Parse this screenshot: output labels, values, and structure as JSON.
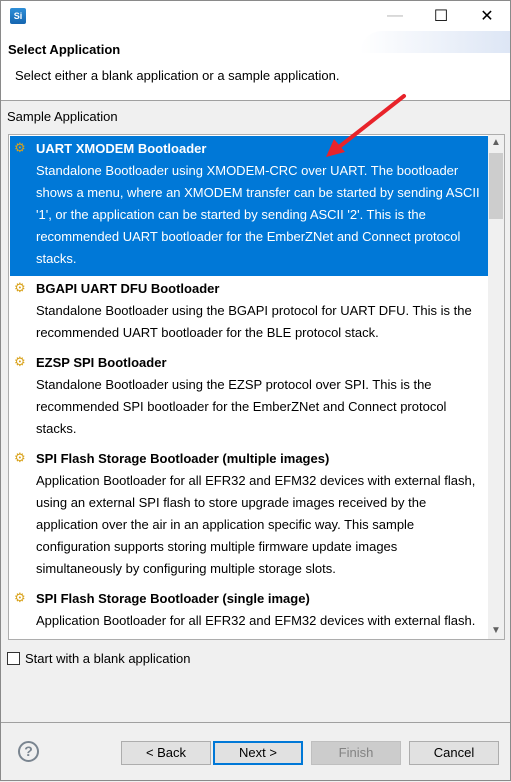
{
  "window": {
    "app_icon_text": "Si",
    "minimize": "—",
    "maximize": "☐",
    "close": "✕"
  },
  "header": {
    "title": "Select Application",
    "subtitle": "Select either a blank application or a sample application."
  },
  "group_label": "Sample Application",
  "items": [
    {
      "title": "UART XMODEM Bootloader",
      "selected": true,
      "lines": [
        "Standalone Bootloader using XMODEM-CRC over UART. The bootloader",
        "shows a menu, where an XMODEM transfer can be started by sending ASCII",
        "'1', or the application can be started by sending ASCII '2'. This is the",
        "recommended UART bootloader for the EmberZNet and Connect protocol",
        "stacks."
      ]
    },
    {
      "title": "BGAPI UART DFU Bootloader",
      "lines": [
        "Standalone Bootloader using the BGAPI protocol for UART DFU. This is the",
        "recommended UART bootloader for the BLE protocol stack."
      ]
    },
    {
      "title": "EZSP SPI Bootloader",
      "lines": [
        "Standalone Bootloader using the EZSP protocol over SPI. This is the",
        "recommended SPI bootloader for the EmberZNet and Connect protocol",
        "stacks."
      ]
    },
    {
      "title": "SPI Flash Storage Bootloader (multiple images)",
      "lines": [
        "Application Bootloader for all EFR32 and EFM32 devices with external flash,",
        "using an external SPI flash to store upgrade images received by the",
        "application over the air in an application specific way. This sample",
        "configuration supports storing multiple firmware update images",
        "simultaneously by configuring multiple storage slots."
      ]
    },
    {
      "title": "SPI Flash Storage Bootloader (single image)",
      "lines": [
        "Application Bootloader for all EFR32 and EFM32 devices with external flash."
      ]
    }
  ],
  "checkbox": {
    "label": "Start with a blank application",
    "checked": false
  },
  "buttons": {
    "help": "?",
    "back": "< Back",
    "next": "Next >",
    "finish": "Finish",
    "cancel": "Cancel"
  },
  "colors": {
    "selection": "#0078d7",
    "annotation_arrow": "#e8232a"
  }
}
